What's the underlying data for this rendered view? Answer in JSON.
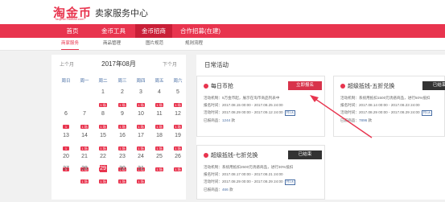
{
  "brand": {
    "logo_text": "淘金币",
    "logo_sub": "Taojinbi.Taobao.com",
    "title": "卖家服务中心"
  },
  "nav": {
    "items": [
      "首页",
      "金币工具",
      "金币招商",
      "合作招募(在建)"
    ],
    "active": 2
  },
  "subnav": {
    "items": [
      "商家服务",
      "商品管理",
      "图片规范",
      "规则流程"
    ],
    "active": 0
  },
  "calendar": {
    "prev": "上个月",
    "next": "下个月",
    "month": "2017年08月",
    "weekdays": [
      "周日",
      "周一",
      "周二",
      "周三",
      "周四",
      "周五",
      "周六"
    ],
    "weeks": [
      [
        {
          "d": "",
          "t": ""
        },
        {
          "d": "",
          "t": ""
        },
        {
          "d": "1",
          "t": "1 场"
        },
        {
          "d": "2",
          "t": "1 场"
        },
        {
          "d": "3",
          "t": "1 场"
        },
        {
          "d": "4",
          "t": "1 场"
        },
        {
          "d": "5",
          "t": "1 场"
        }
      ],
      [
        {
          "d": "6",
          "t": "1"
        },
        {
          "d": "7",
          "t": "1 场"
        },
        {
          "d": "8",
          "t": "1 场"
        },
        {
          "d": "9",
          "t": "1 场"
        },
        {
          "d": "10",
          "t": "1 场"
        },
        {
          "d": "11",
          "t": "1 场"
        },
        {
          "d": "12",
          "t": "1 场"
        }
      ],
      [
        {
          "d": "13",
          "t": "1"
        },
        {
          "d": "14",
          "t": "1 场"
        },
        {
          "d": "15",
          "t": "1 场"
        },
        {
          "d": "16",
          "t": "1 场"
        },
        {
          "d": "17",
          "t": "1 场"
        },
        {
          "d": "18",
          "t": "1 场"
        },
        {
          "d": "19",
          "t": "1 场"
        }
      ],
      [
        {
          "d": "20",
          "t": "1"
        },
        {
          "d": "21",
          "t": "1 场"
        },
        {
          "d": "22",
          "t": "1 场"
        },
        {
          "d": "23",
          "t": "1 场"
        },
        {
          "d": "24",
          "t": "1 场"
        },
        {
          "d": "25",
          "t": "1 场"
        },
        {
          "d": "26",
          "t": "1 场"
        }
      ],
      [
        {
          "d": "27",
          "t": ""
        },
        {
          "d": "28",
          "t": "1 场"
        },
        {
          "d": "29",
          "t": "1 场"
        },
        {
          "d": "30",
          "t": "1 场"
        },
        {
          "d": "31",
          "t": "1 场"
        },
        {
          "d": "",
          "t": ""
        },
        {
          "d": "",
          "t": ""
        }
      ]
    ],
    "today": "29"
  },
  "activities": {
    "title": "日常活动",
    "cards": [
      {
        "name": "每日币抢",
        "button": "立即报名",
        "lines": [
          "活动机制：5万金币起，展示在淘币商品列表中",
          "报名时间：2017.08.15 00:00 - 2017.08.25 24:00",
          "活动时间：2017.08.29 00:00 - 2017.09.12 24:00"
        ],
        "limit": "共1天",
        "signed_label": "已报商品：",
        "signed_count": "1244",
        "signed_unit": "款"
      },
      {
        "name": "超级抵钱-五折兑换",
        "button": "已结束",
        "lines": [
          "活动机制：系统用抵扣1500元诱惑商品，进行50%抵扣",
          "报名时间：2017.08.14 00:00 - 2017.08.23 24:00",
          "活动时间：2017.08.29 00:00 - 2017.08.29 24:00"
        ],
        "limit": "共1天",
        "signed_label": "已报商品：",
        "signed_count": "7896",
        "signed_unit": "款"
      },
      {
        "name": "超级抵钱-七折兑换",
        "button": "已结束",
        "lines": [
          "活动机制：系统用抵扣2500元诱惑商品，进行30%抵扣",
          "报名时间：2017.08.17 00:00 - 2017.08.21 24:00",
          "活动时间：2017.08.29 00:00 - 2017.08.29 24:00"
        ],
        "limit": "共1天",
        "signed_label": "已报商品：",
        "signed_count": "466",
        "signed_unit": "款"
      }
    ]
  },
  "colors": {
    "brand": "#e8344e",
    "nav_active": "#c91f37",
    "link": "#4a6fa5"
  }
}
